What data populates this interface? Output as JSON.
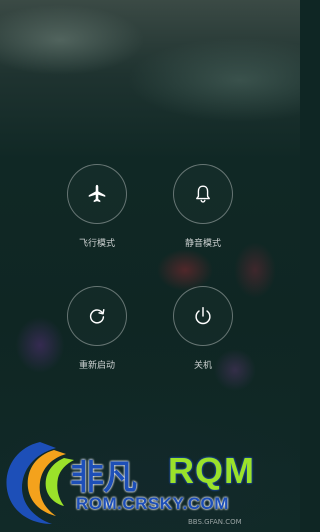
{
  "actions": [
    {
      "id": "airplane",
      "label": "飞行模式",
      "icon": "airplane-icon"
    },
    {
      "id": "silent",
      "label": "静音模式",
      "icon": "bell-icon"
    },
    {
      "id": "reboot",
      "label": "重新启动",
      "icon": "reboot-icon"
    },
    {
      "id": "power",
      "label": "关机",
      "icon": "power-icon"
    }
  ],
  "watermark": {
    "brand_cn": "非凡",
    "brand_en": "RQM",
    "url": "ROM.CRSKY.COM",
    "forum": "BBS.GFAN.COM"
  },
  "colors": {
    "background": "#0f2624",
    "ring": "rgba(255,255,255,0.35)",
    "text": "#ffffff",
    "watermark_green": "#9be22a",
    "watermark_blue": "#1d4fb8",
    "watermark_orange": "#f4a21c"
  }
}
